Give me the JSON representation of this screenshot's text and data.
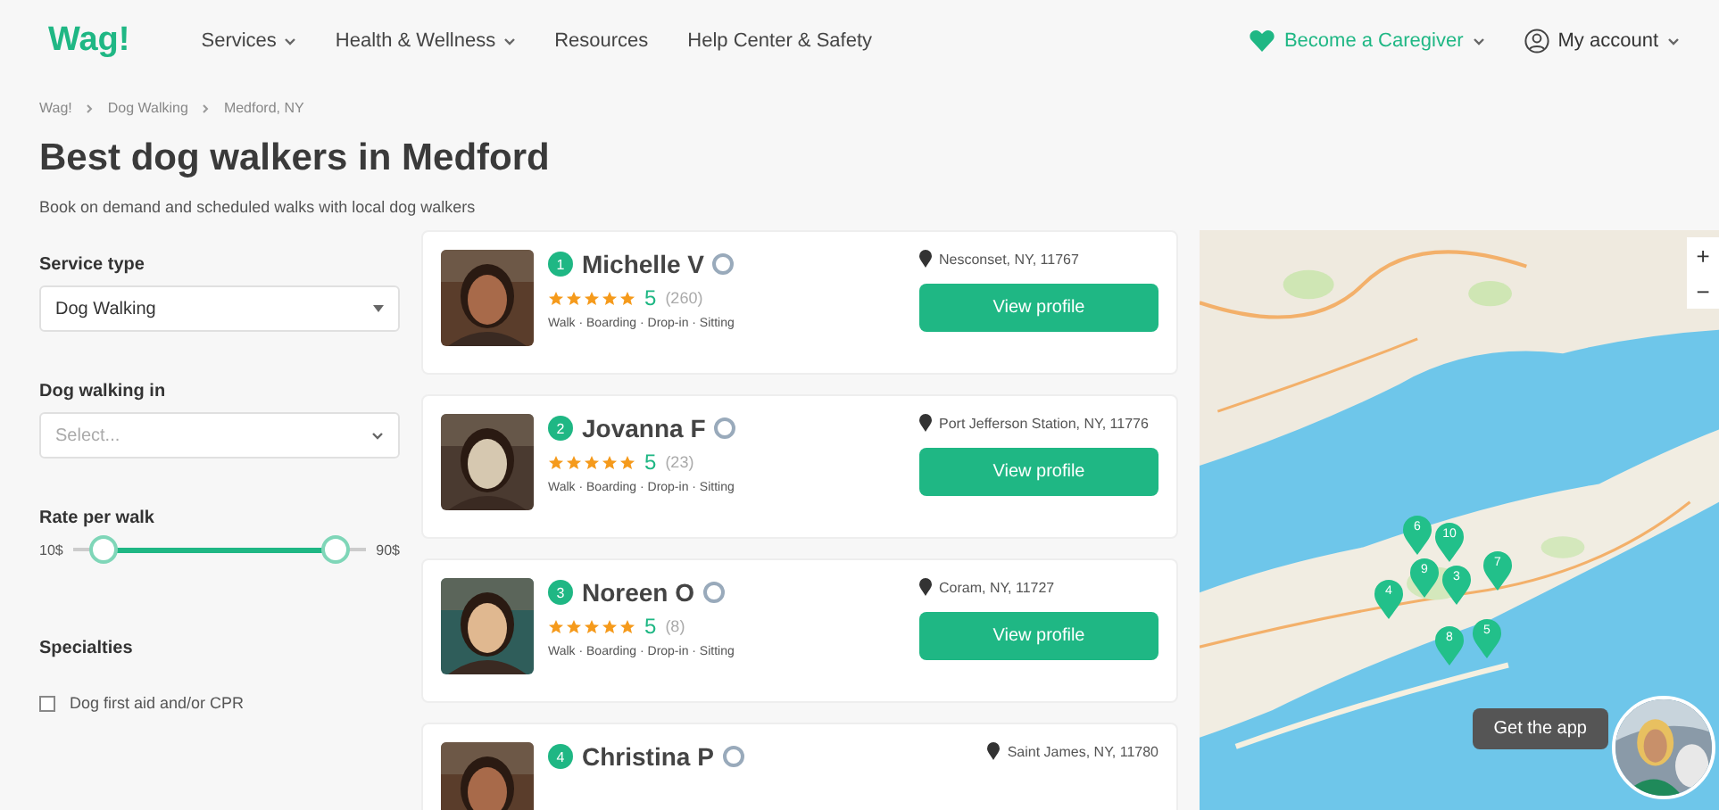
{
  "header": {
    "logo": "Wag!",
    "nav": [
      {
        "label": "Services",
        "dropdown": true
      },
      {
        "label": "Health & Wellness",
        "dropdown": true
      },
      {
        "label": "Resources",
        "dropdown": false
      },
      {
        "label": "Help Center & Safety",
        "dropdown": false
      }
    ],
    "caregiver": "Become a Caregiver",
    "account": "My account"
  },
  "breadcrumbs": [
    "Wag!",
    "Dog Walking",
    "Medford, NY"
  ],
  "title": "Best dog walkers in Medford",
  "subtitle": "Book on demand and scheduled walks with local dog walkers",
  "filters": {
    "service_type": {
      "label": "Service type",
      "value": "Dog Walking"
    },
    "location": {
      "label": "Dog walking in",
      "placeholder": "Select..."
    },
    "rate": {
      "label": "Rate per walk",
      "min": "10$",
      "max": "90$",
      "handles": [
        {
          "level": 0.1
        },
        {
          "level": 0.9
        }
      ]
    },
    "specialties": {
      "label": "Specialties",
      "options": [
        {
          "label": "Dog first aid and/or CPR",
          "checked": false
        }
      ]
    }
  },
  "walkers": [
    {
      "rank": "1",
      "name": "Michelle V",
      "stars": 5,
      "rating": "5",
      "reviews": "(260)",
      "services": "Walk · Boarding · Drop-in · Sitting",
      "location": "Nesconset, NY, 11767",
      "button": "View profile"
    },
    {
      "rank": "2",
      "name": "Jovanna F",
      "stars": 5,
      "rating": "5",
      "reviews": "(23)",
      "services": "Walk · Boarding · Drop-in · Sitting",
      "location": "Port Jefferson Station, NY, 11776",
      "button": "View profile"
    },
    {
      "rank": "3",
      "name": "Noreen O",
      "stars": 5,
      "rating": "5",
      "reviews": "(8)",
      "services": "Walk · Boarding · Drop-in · Sitting",
      "location": "Coram, NY, 11727",
      "button": "View profile"
    },
    {
      "rank": "4",
      "name": "Christina P",
      "location": "Saint James, NY, 11780"
    }
  ],
  "map": {
    "zoom_in": "+",
    "zoom_out": "−",
    "pins": [
      "6",
      "10",
      "9",
      "3",
      "7",
      "4",
      "8",
      "5"
    ],
    "get_app": "Get the app"
  }
}
